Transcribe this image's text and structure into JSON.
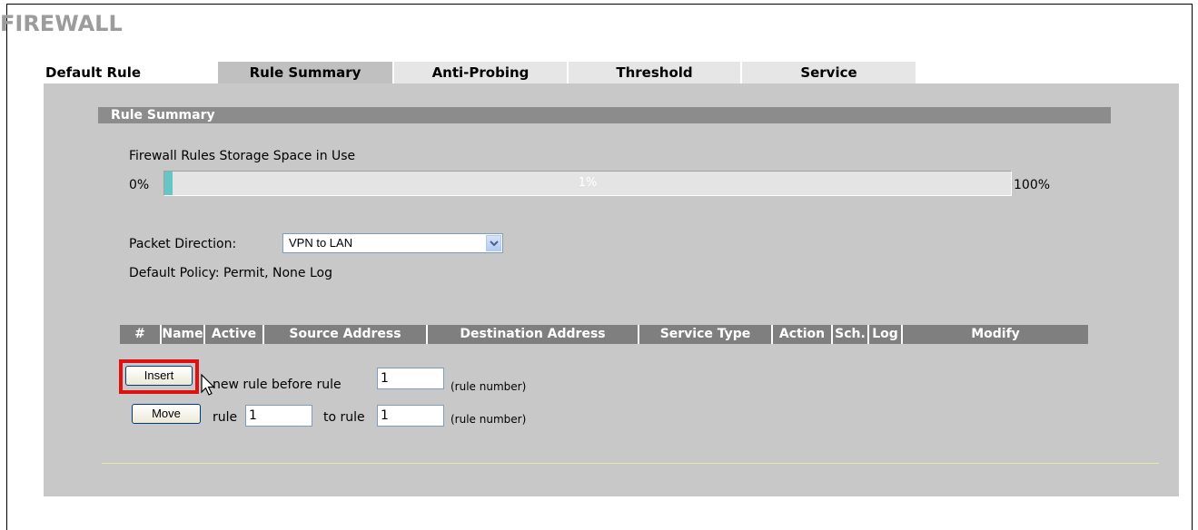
{
  "page": {
    "title": "FIREWALL"
  },
  "tabs": [
    {
      "label": "Default Rule",
      "active": false
    },
    {
      "label": "Rule Summary",
      "active": true
    },
    {
      "label": "Anti-Probing",
      "active": false
    },
    {
      "label": "Threshold",
      "active": false
    },
    {
      "label": "Service",
      "active": false
    }
  ],
  "section": {
    "title": "Rule Summary"
  },
  "storage": {
    "label": "Firewall Rules Storage Space in Use",
    "min_label": "0%",
    "max_label": "100%",
    "value_label": "1%",
    "value_fraction": 0.01,
    "fill_color": "#66c5c5"
  },
  "direction": {
    "label": "Packet Direction:",
    "selected": "VPN to LAN",
    "arrow_icon": "chevron-down-icon"
  },
  "policy": {
    "text": "Default Policy: Permit, None Log"
  },
  "table": {
    "headers": [
      "#",
      "Name",
      "Active",
      "Source Address",
      "Destination Address",
      "Service Type",
      "Action",
      "Sch.",
      "Log",
      "Modify"
    ]
  },
  "insert_row": {
    "button": "Insert",
    "text": "new rule before rule",
    "value": "1",
    "hint": "(rule number)",
    "highlight_color": "#e01010"
  },
  "move_row": {
    "button": "Move",
    "text_rule": "rule",
    "from_value": "1",
    "text_to": "to rule",
    "to_value": "1",
    "hint": "(rule number)"
  },
  "colors": {
    "title": "#9c9c9c",
    "panel": "#c8c8c8",
    "section_bar": "#8c8c8c",
    "header_cell": "#7f7f7f"
  }
}
